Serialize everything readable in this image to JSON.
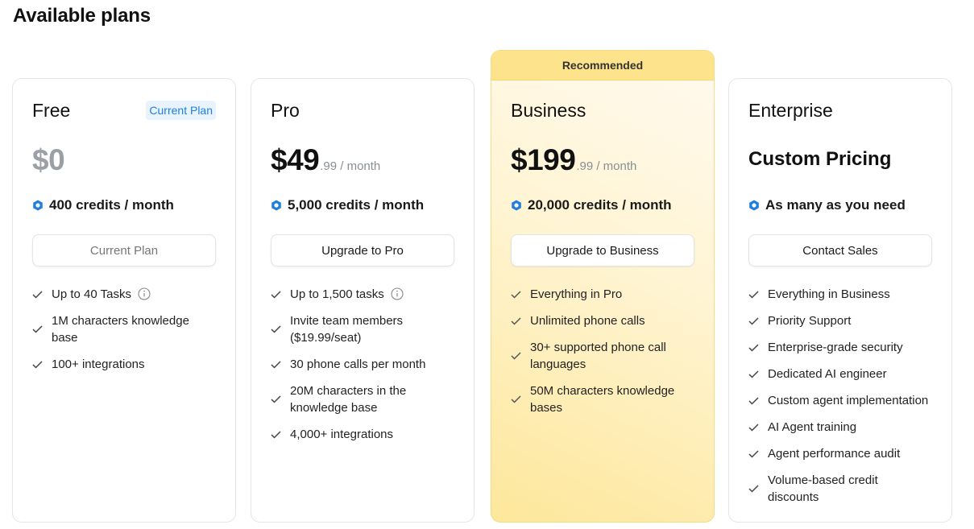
{
  "page": {
    "title": "Available plans"
  },
  "colors": {
    "accent": "#1f7fe0",
    "recommended": "#fde38b"
  },
  "icons": {
    "credits": "hexagon-credits-icon",
    "feature": "check-icon",
    "info": "info-icon"
  },
  "plans": [
    {
      "name": "Free",
      "badge": "Current Plan",
      "price": "$0",
      "credits": "400 credits / month",
      "cta": "Current Plan",
      "features": [
        "Up to 40 Tasks",
        "1M characters knowledge base",
        "100+ integrations"
      ]
    },
    {
      "name": "Pro",
      "price": "$49",
      "price_suffix": ".99 / month",
      "credits": "5,000 credits / month",
      "cta": "Upgrade to Pro",
      "features": [
        "Up to 1,500 tasks",
        "Invite team members ($19.99/seat)",
        "30 phone calls per month",
        "20M characters in the knowledge base",
        "4,000+ integrations"
      ]
    },
    {
      "name": "Business",
      "banner": "Recommended",
      "price": "$199",
      "price_suffix": ".99 / month",
      "credits": "20,000 credits / month",
      "cta": "Upgrade to Business",
      "features": [
        "Everything in Pro",
        "Unlimited phone calls",
        "30+ supported phone call languages",
        "50M characters knowledge bases"
      ]
    },
    {
      "name": "Enterprise",
      "price": "Custom Pricing",
      "credits": "As many as you need",
      "cta": "Contact Sales",
      "features": [
        "Everything in Business",
        "Priority Support",
        "Enterprise-grade security",
        "Dedicated AI engineer",
        "Custom agent implementation",
        "AI Agent training",
        "Agent performance audit",
        "Volume-based credit discounts"
      ]
    }
  ]
}
